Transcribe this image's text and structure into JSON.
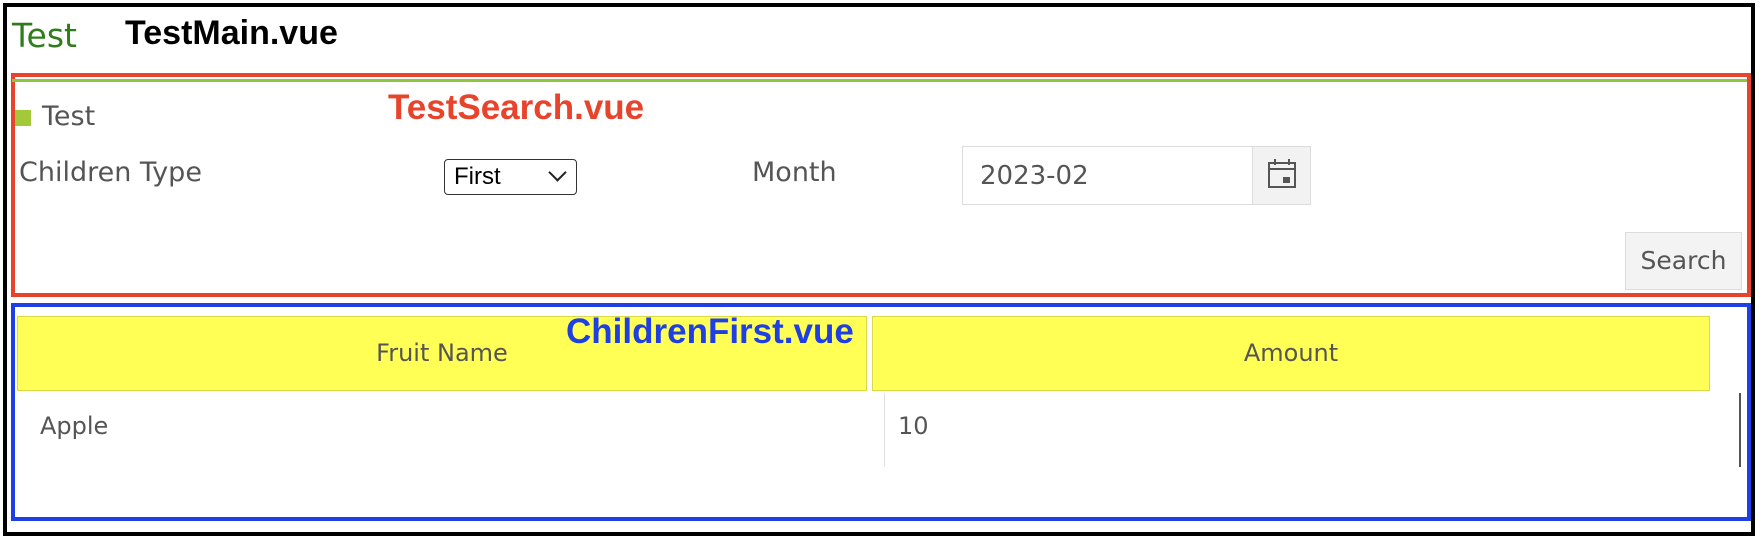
{
  "header": {
    "brand": "Test",
    "title": "TestMain.vue"
  },
  "search": {
    "annotation": "TestSearch.vue",
    "section_label": "Test",
    "children_type_label": "Children Type",
    "children_type_value": "First",
    "month_label": "Month",
    "month_value": "2023-02",
    "search_button": "Search"
  },
  "children": {
    "annotation": "ChildrenFirst.vue",
    "columns": [
      "Fruit Name",
      "Amount"
    ],
    "rows": [
      [
        "Apple",
        "10"
      ]
    ]
  },
  "colors": {
    "search_frame": "#e8432b",
    "children_frame": "#1f3fe6",
    "header_row": "#ffff55",
    "brand": "#2f7d1a"
  }
}
